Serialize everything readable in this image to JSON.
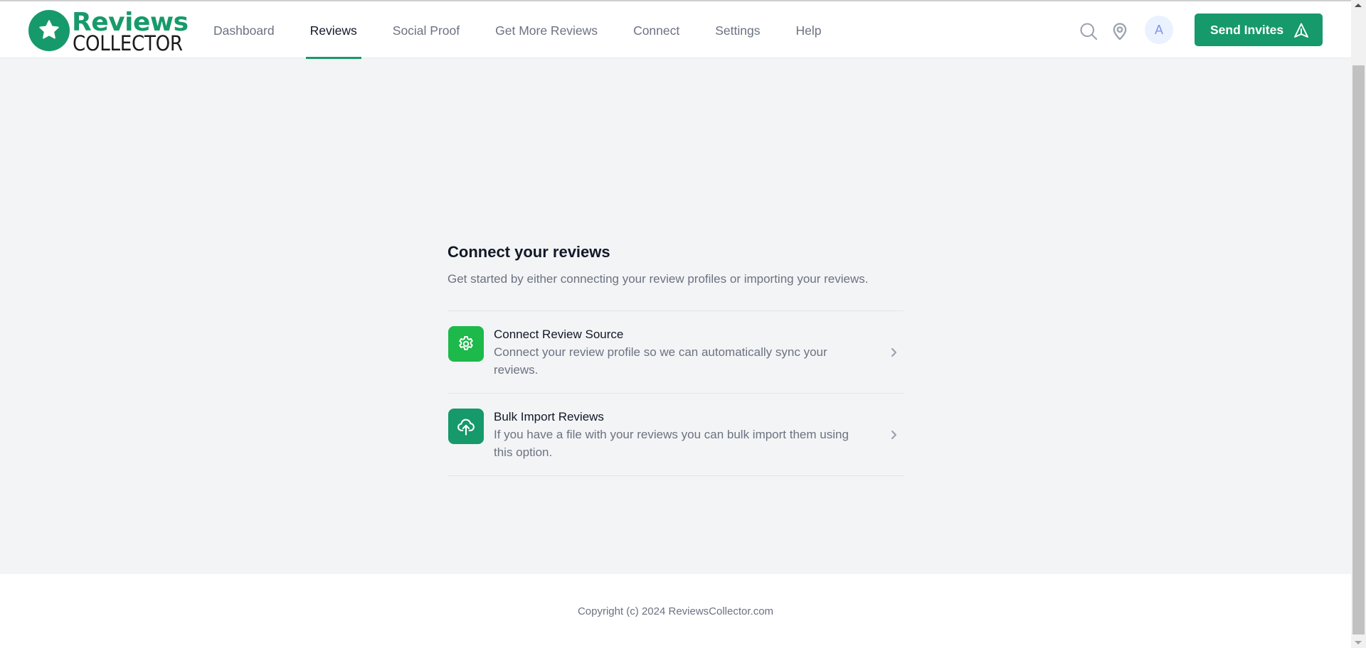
{
  "app": {
    "logo": {
      "line1": "Reviews",
      "line2": "COLLECTOR",
      "icon": "star-icon"
    },
    "brand_color": "#16996b"
  },
  "nav": {
    "items": [
      {
        "label": "Dashboard",
        "active": false
      },
      {
        "label": "Reviews",
        "active": true
      },
      {
        "label": "Social Proof",
        "active": false
      },
      {
        "label": "Get More Reviews",
        "active": false
      },
      {
        "label": "Connect",
        "active": false
      },
      {
        "label": "Settings",
        "active": false
      },
      {
        "label": "Help",
        "active": false
      }
    ]
  },
  "header": {
    "search_icon": "search-icon",
    "location_icon": "map-pin-icon",
    "avatar_initial": "A",
    "send_button": {
      "label": "Send Invites",
      "icon": "send-icon"
    }
  },
  "main": {
    "title": "Connect your reviews",
    "subtitle": "Get started by either connecting your review profiles or importing your reviews.",
    "options": [
      {
        "title": "Connect Review Source",
        "description": "Connect your review profile so we can automatically sync your reviews.",
        "icon": "gear-icon",
        "icon_bg": "#1db94a"
      },
      {
        "title": "Bulk Import Reviews",
        "description": "If you have a file with your reviews you can bulk import them using this option.",
        "icon": "cloud-upload-icon",
        "icon_bg": "#16996b"
      }
    ]
  },
  "footer": {
    "copyright": "Copyright (c) 2024 ReviewsCollector.com"
  }
}
